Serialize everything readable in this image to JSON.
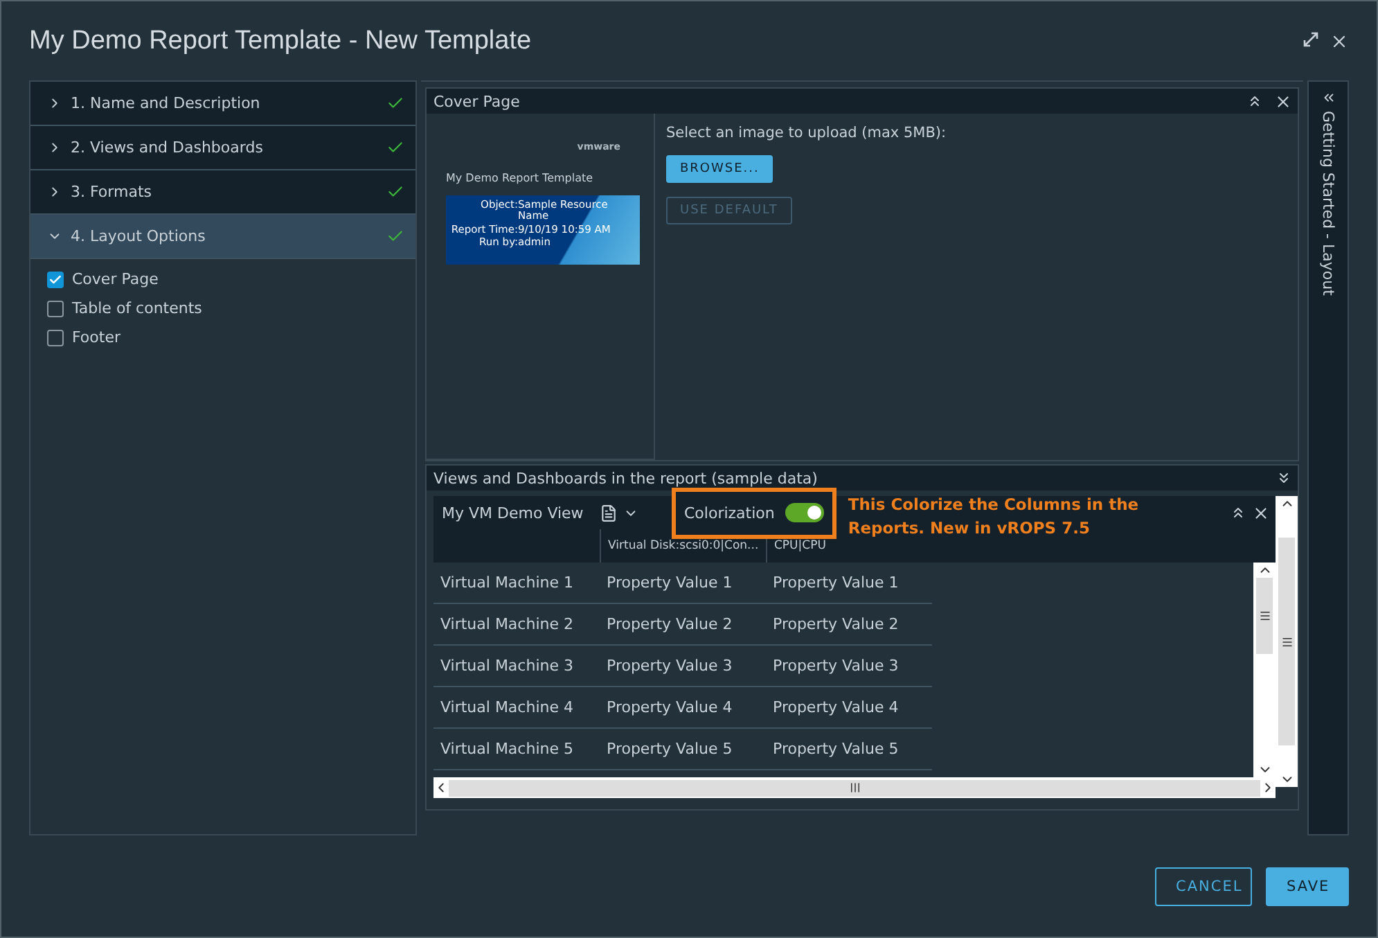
{
  "window": {
    "title": "My Demo Report Template - New Template"
  },
  "steps": [
    {
      "label": "1. Name and Description",
      "expanded": false,
      "selected": false,
      "done": true
    },
    {
      "label": "2. Views and Dashboards",
      "expanded": false,
      "selected": false,
      "done": true
    },
    {
      "label": "3. Formats",
      "expanded": false,
      "selected": false,
      "done": true
    },
    {
      "label": "4. Layout Options",
      "expanded": true,
      "selected": true,
      "done": true
    }
  ],
  "layout_options": [
    {
      "label": "Cover Page",
      "checked": true
    },
    {
      "label": "Table of contents",
      "checked": false
    },
    {
      "label": "Footer",
      "checked": false
    }
  ],
  "cover_page": {
    "title": "Cover Page",
    "preview": {
      "logo": "vmware",
      "report_title": "My Demo Report Template",
      "fields": [
        {
          "label": "Object:",
          "value": "Sample Resource Name"
        },
        {
          "label": "Report Time:",
          "value": "9/10/19 10:59 AM"
        },
        {
          "label": "Run by:",
          "value": "admin"
        }
      ]
    },
    "upload_hint": "Select an image to upload (max 5MB):",
    "browse": "BROWSE...",
    "use_default": {
      "label": "USE DEFAULT",
      "disabled": true
    }
  },
  "views_panel": {
    "title": "Views and Dashboards in the report (sample data)",
    "view": {
      "name": "My VM Demo View",
      "colorization": {
        "label": "Colorization",
        "on": true
      },
      "annotation": "This Colorize the Columns in the Reports. New in vROPS 7.5",
      "columns": [
        "",
        "Virtual Disk:scsi0:0|Con...",
        "CPU|CPU"
      ],
      "rows": [
        [
          "Virtual Machine 1",
          "Property Value 1",
          "Property Value 1"
        ],
        [
          "Virtual Machine 2",
          "Property Value 2",
          "Property Value 2"
        ],
        [
          "Virtual Machine 3",
          "Property Value 3",
          "Property Value 3"
        ],
        [
          "Virtual Machine 4",
          "Property Value 4",
          "Property Value 4"
        ],
        [
          "Virtual Machine 5",
          "Property Value 5",
          "Property Value 5"
        ]
      ]
    }
  },
  "side_tab": {
    "label": "Getting Started - Layout"
  },
  "buttons": [
    {
      "label": "CANCEL",
      "kind": "secondary"
    },
    {
      "label": "SAVE",
      "kind": "primary"
    }
  ]
}
